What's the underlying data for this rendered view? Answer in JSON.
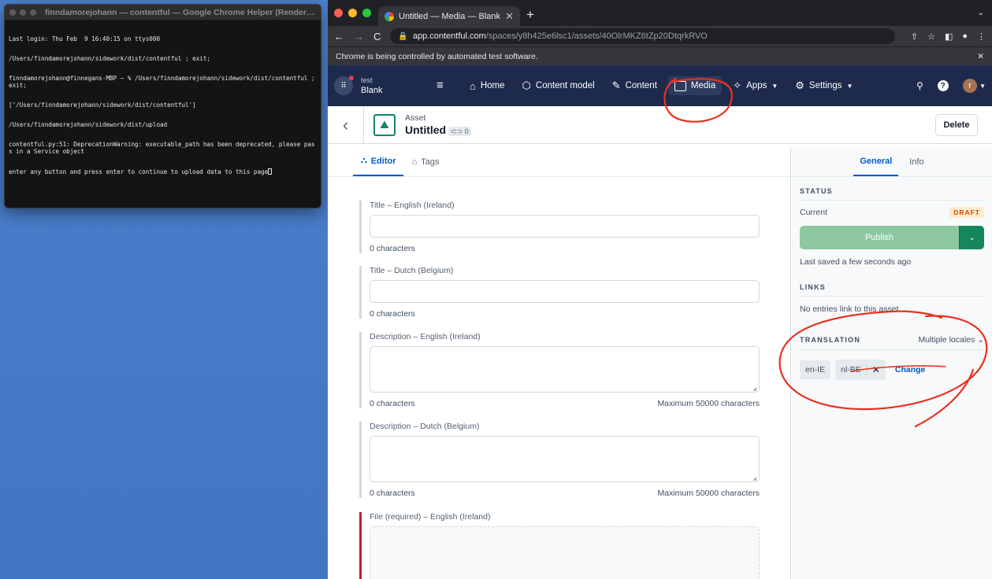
{
  "terminal": {
    "title": "finndamorejohann — contentful — Google Chrome Helper (Renderer) ‹ co...",
    "lines": [
      "Last login: Thu Feb  9 16:40:15 on ttys000",
      "/Users/finndamorejohann/sidework/dist/contentful ; exit;",
      "finndamorejohann@finnegans-MBP ~ % /Users/finndamorejohann/sidework/dist/contentful ; exit;",
      "['/Users/finndamorejohann/sidework/dist/contentful']",
      "/Users/finndamorejohann/sidework/dist/upload",
      "contentful.py:51: DeprecationWarning: executable_path has been deprecated, please pass in a Service object",
      "enter any button and press enter to continue to upload data to this page"
    ]
  },
  "browser": {
    "tab_title": "Untitled — Media — Blank — C",
    "url_host": "app.contentful.com",
    "url_path": "/spaces/y8h425e6lsc1/assets/40OlrMKZ6tZp20DtqrkRVO",
    "infobar_text": "Chrome is being controlled by automated test software."
  },
  "nav": {
    "space_label": "test",
    "env_label": "Blank",
    "items": [
      {
        "label": "Home",
        "icon": "home-icon"
      },
      {
        "label": "Content model",
        "icon": "cube-icon"
      },
      {
        "label": "Content",
        "icon": "edit-icon"
      },
      {
        "label": "Media",
        "icon": "media-icon"
      },
      {
        "label": "Apps",
        "icon": "puzzle-icon"
      },
      {
        "label": "Settings",
        "icon": "gear-icon"
      }
    ],
    "avatar_letter": "f"
  },
  "asset": {
    "type_label": "Asset",
    "title": "Untitled",
    "ref_count": "0",
    "delete_label": "Delete"
  },
  "editor": {
    "tabs": [
      "Editor",
      "Tags"
    ],
    "fields": [
      {
        "label": "Title – English (Ireland)",
        "count": "0 characters",
        "max": ""
      },
      {
        "label": "Title – Dutch (Belgium)",
        "count": "0 characters",
        "max": ""
      },
      {
        "label": "Description – English (Ireland)",
        "count": "0 characters",
        "max": "Maximum 50000 characters"
      },
      {
        "label": "Description – Dutch (Belgium)",
        "count": "0 characters",
        "max": "Maximum 50000 characters"
      },
      {
        "label": "File (required) – English (Ireland)",
        "count": "",
        "max": ""
      }
    ]
  },
  "sidebar": {
    "tabs": [
      "General",
      "Info"
    ],
    "status_heading": "STATUS",
    "current_label": "Current",
    "status_badge": "DRAFT",
    "publish_label": "Publish",
    "last_saved": "Last saved a few seconds ago",
    "links_heading": "LINKS",
    "links_text": "No entries link to this asset.",
    "translation_heading": "TRANSLATION",
    "locales_dropdown": "Multiple locales",
    "locale_pills": [
      "en-IE",
      "nl-BE"
    ],
    "change_label": "Change"
  },
  "colors": {
    "nav_bg": "#1d2a4c",
    "accent_blue": "#0059c8",
    "publish_green": "#16875d",
    "annotation_red": "#e8321e"
  }
}
